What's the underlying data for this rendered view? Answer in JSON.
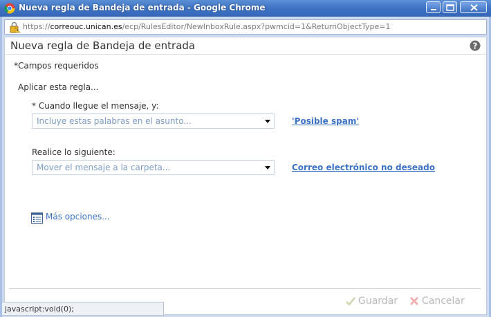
{
  "window": {
    "title": "Nueva regla de Bandeja de entrada - Google Chrome",
    "titlebar_color": "#3d72c2"
  },
  "addressbar": {
    "scheme": "https://",
    "host": "correouc.unican.es",
    "path": "/ecp/RulesEditor/NewInboxRule.aspx?pwmcid=1&ReturnObjectType=1"
  },
  "page": {
    "title": "Nueva regla de Bandeja de entrada",
    "required_note": "*Campos requeridos",
    "apply_rule_label": "Aplicar esta regla..."
  },
  "condition": {
    "label": "* Cuando llegue el mensaje, y:",
    "selected": "Incluye estas palabras en el asunto...",
    "value_link": "'Posible spam'"
  },
  "action": {
    "label": "Realice lo siguiente:",
    "selected": "Mover el mensaje a la carpeta...",
    "value_link": "Correo electrónico no deseado"
  },
  "more_options": {
    "label": "Más opciones..."
  },
  "footer": {
    "save_label": "Guardar",
    "cancel_label": "Cancelar"
  },
  "status": {
    "text": "javascript:void(0);"
  },
  "colors": {
    "link": "#3c72c6",
    "select_text": "#7c9cc6",
    "disabled": "#b9b9b9"
  },
  "icons": {
    "browser": "chrome-logo-icon",
    "security": "lock-warning-icon",
    "help": "help-icon",
    "more": "list-icon",
    "save": "checkmark-icon",
    "cancel": "x-icon"
  }
}
